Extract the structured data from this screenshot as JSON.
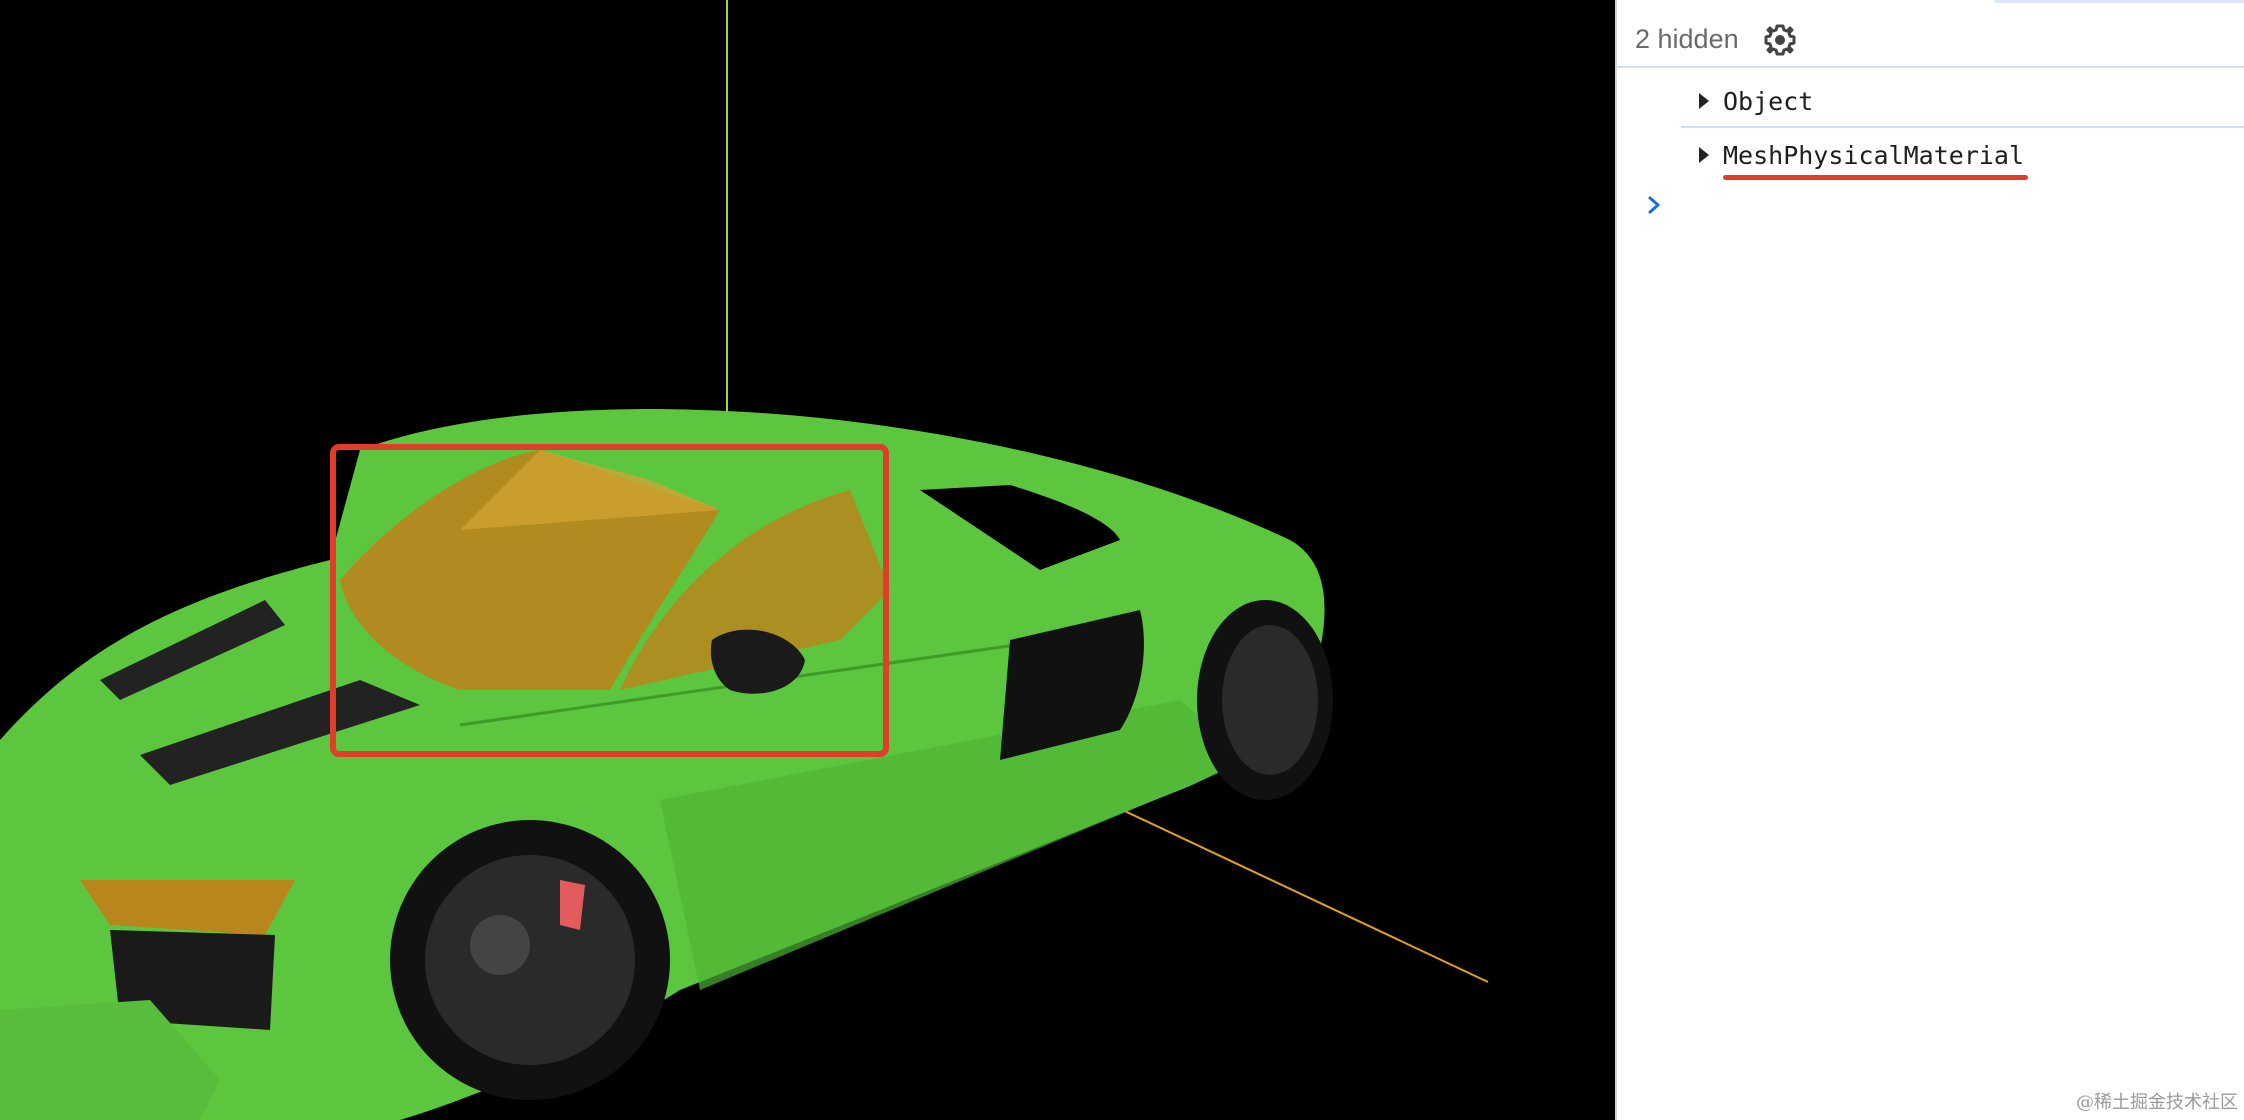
{
  "console": {
    "hidden_count": "2 hidden",
    "settings_icon": "gear-icon",
    "entries": [
      {
        "label": "Object",
        "underlined": false
      },
      {
        "label": "MeshPhysicalMaterial",
        "underlined": true
      }
    ],
    "prompt_icon": "chevron-right-icon"
  },
  "scene": {
    "car_color": "#5cc63e",
    "glass_color": "#b8861c",
    "highlight_box_color": "#e03e2a",
    "axis_y_color": "#9edb3c",
    "axis_x_color": "#e3a11b"
  },
  "watermark": "@稀土掘金技术社区"
}
